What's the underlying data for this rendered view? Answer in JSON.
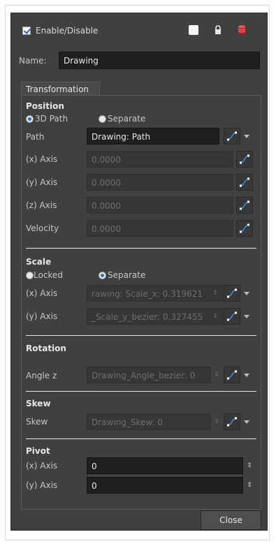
{
  "header": {
    "enable_label": "Enable/Disable",
    "enabled": true,
    "icons": [
      "white-square-icon",
      "lock-icon",
      "database-icon"
    ]
  },
  "name_field": {
    "label": "Name:",
    "value": "Drawing"
  },
  "tabs": [
    {
      "label": "Transformation"
    }
  ],
  "position": {
    "title": "Position",
    "mode_3d_label": "3D Path",
    "mode_separate_label": "Separate",
    "selected_mode": "3D Path",
    "path_label": "Path",
    "path_value": "Drawing: Path",
    "x_label": "(x) Axis",
    "x_value": "0.0000",
    "y_label": "(y) Axis",
    "y_value": "0.0000",
    "z_label": "(z) Axis",
    "z_value": "0.0000",
    "velocity_label": "Velocity",
    "velocity_value": "0.0000"
  },
  "scale": {
    "title": "Scale",
    "locked_label": "Locked",
    "separate_label": "Separate",
    "selected_mode": "Separate",
    "x_label": "(x) Axis",
    "x_value": "rawing: Scale_x: 0.319621",
    "y_label": "(y) Axis",
    "y_value": "_Scale_y_bezier: 0.327455"
  },
  "rotation": {
    "title": "Rotation",
    "angle_label": "Angle z",
    "angle_value": "Drawing_Angle_bezier: 0"
  },
  "skew": {
    "title": "Skew",
    "skew_label": "Skew",
    "skew_value": "Drawing_Skew: 0"
  },
  "pivot": {
    "title": "Pivot",
    "x_label": "(x) Axis",
    "x_value": "0",
    "y_label": "(y) Axis",
    "y_value": "0"
  },
  "footer": {
    "close_label": "Close"
  },
  "colors": {
    "background": "#404040",
    "field_dark": "#1f1f1f",
    "accent": "#2f69d6"
  }
}
